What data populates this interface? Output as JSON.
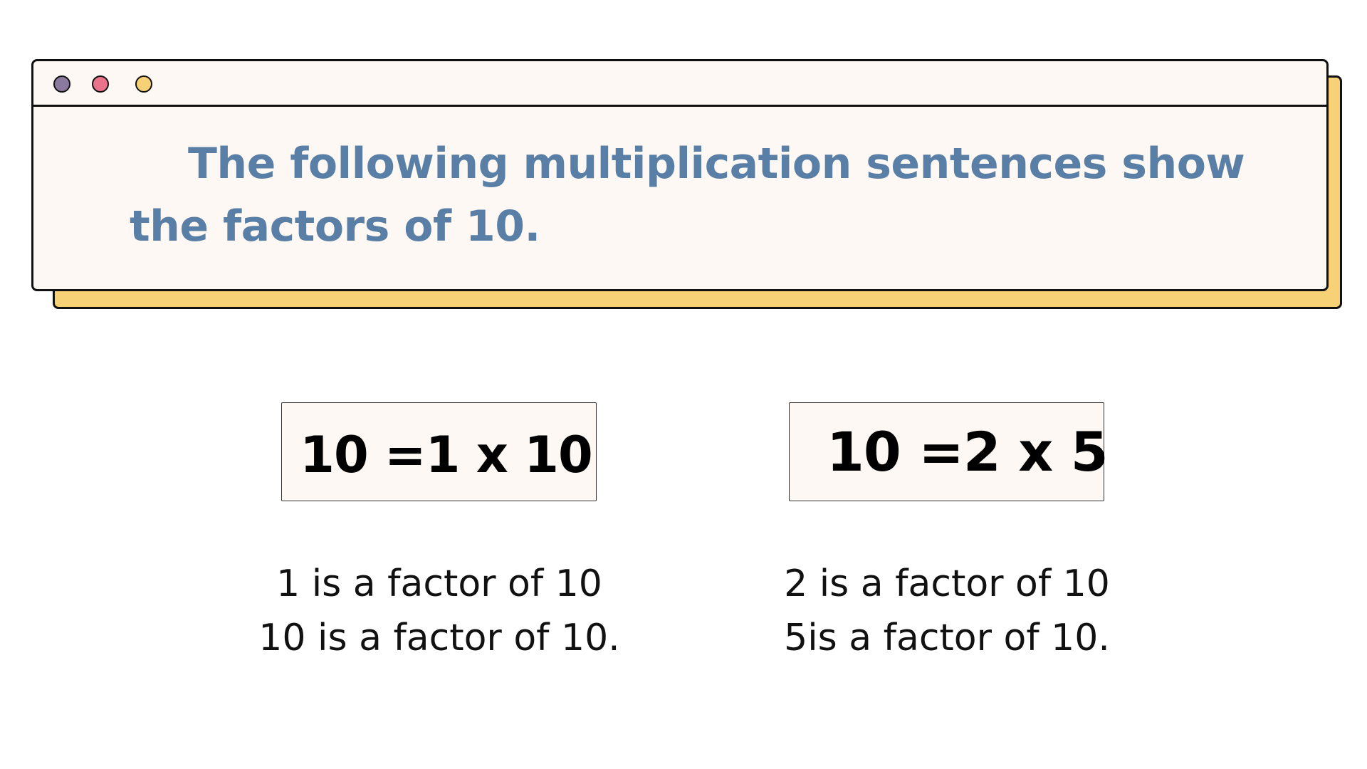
{
  "window": {
    "dots": [
      {
        "name": "purple",
        "color": "#8a7aa0"
      },
      {
        "name": "pink",
        "color": "#e8738a"
      },
      {
        "name": "yellow",
        "color": "#f7d175"
      }
    ],
    "heading": "The following multiplication sentences show the factors of 10."
  },
  "equations": [
    {
      "text": "10 =1 x 10"
    },
    {
      "text": "10 =2 x 5"
    }
  ],
  "facts": {
    "left": [
      "1 is a factor of 10",
      "10 is a factor of 10."
    ],
    "right": [
      "2 is a factor of 10",
      "5is a factor of 10."
    ]
  },
  "colors": {
    "heading": "#5a7fa6",
    "window_bg": "#fdf8f3",
    "shadow": "#f7d175"
  }
}
